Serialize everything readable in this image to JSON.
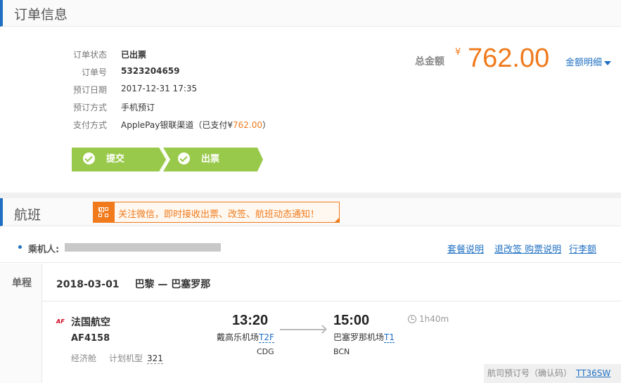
{
  "order": {
    "title": "订单信息",
    "rows": [
      {
        "label": "订单状态",
        "value": "已出票"
      },
      {
        "label": "订单号",
        "value": "5323204659"
      },
      {
        "label": "预订日期",
        "value": "2017-12-31 17:35"
      },
      {
        "label": "预订方式",
        "value": "手机预订"
      },
      {
        "label": "支付方式",
        "value": "ApplePay银联渠道",
        "paid_prefix": "（已支付¥",
        "paid_amount": "762.00",
        "paid_suffix": "）"
      }
    ],
    "total_label": "总金额",
    "currency": "¥",
    "total_amount": "762.00",
    "detail_link": "金额明细",
    "steps": [
      "提交",
      "出票"
    ],
    "step_color": "#98c94a",
    "accent_color": "#f07a1c",
    "link_color": "#1e6fc2"
  },
  "flight": {
    "title": "航班",
    "banner": "关注微信，即时接收出票、改签、航班动态通知！",
    "passenger_label": "乘机人:",
    "links": [
      "套餐说明",
      "退改签 购票说明",
      "行李额"
    ],
    "leg_label": "单程",
    "date": "2018-03-01",
    "route": "巴黎 — 巴塞罗那",
    "airline_logo": "AF",
    "airline": "法国航空",
    "flight_no": "AF4158",
    "cabin": "经济舱",
    "plane_label": "计划机型",
    "plane": "321",
    "dep_time": "13:20",
    "dep_airport": "戴高乐机场",
    "dep_terminal": "T2F",
    "dep_code": "CDG",
    "arr_time": "15:00",
    "arr_airport": "巴塞罗那机场",
    "arr_terminal": "T1",
    "arr_code": "BCN",
    "duration": "1h40m",
    "pnr_label": "航司预订号（确认码）",
    "pnr": "TT36SW"
  }
}
